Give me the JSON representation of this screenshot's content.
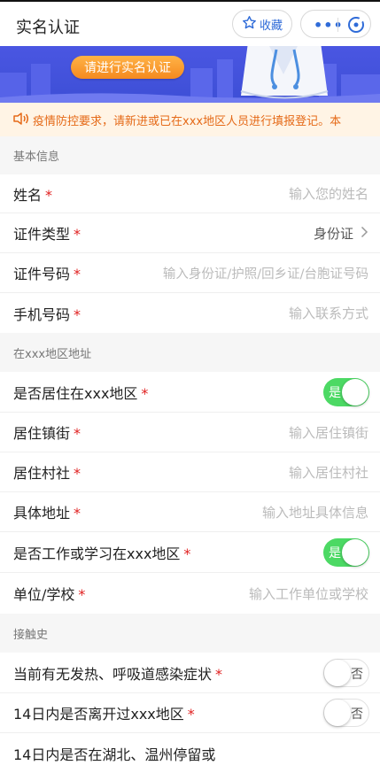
{
  "header": {
    "title": "实名认证",
    "favorite_label": "收藏",
    "more_label": "•••"
  },
  "banner": {
    "button_label": "请进行实名认证"
  },
  "notice": {
    "text": "疫情防控要求，请新进或已在xxx地区人员进行填报登记。本"
  },
  "sections": {
    "basic": "基本信息",
    "address": "在xxx地区地址",
    "contact_history": "接触史"
  },
  "required_mark": "*",
  "fields": {
    "name": {
      "label": "姓名",
      "placeholder": "输入您的姓名"
    },
    "id_type": {
      "label": "证件类型",
      "value": "身份证"
    },
    "id_number": {
      "label": "证件号码",
      "placeholder": "输入身份证/护照/回乡证/台胞证号码"
    },
    "phone": {
      "label": "手机号码",
      "placeholder": "输入联系方式"
    },
    "reside": {
      "label": "是否居住在xxx地区",
      "toggle": "是",
      "checked": true
    },
    "street": {
      "label": "居住镇街",
      "placeholder": "输入居住镇街"
    },
    "village": {
      "label": "居住村社",
      "placeholder": "输入居住村社"
    },
    "address": {
      "label": "具体地址",
      "placeholder": "输入地址具体信息"
    },
    "work_study": {
      "label": "是否工作或学习在xxx地区",
      "toggle": "是",
      "checked": true
    },
    "employer": {
      "label": "单位/学校",
      "placeholder": "输入工作单位或学校"
    },
    "symptoms": {
      "label": "当前有无发热、呼吸道感染症状",
      "toggle": "否",
      "checked": false
    },
    "left_area": {
      "label": "14日内是否离开过xxx地区",
      "toggle": "否",
      "checked": false
    },
    "stay": {
      "label": "14日内是否在湖北、温州停留或"
    }
  },
  "colors": {
    "accent": "#2f6bd8",
    "banner": "#4a56e2",
    "notice_text": "#e56a18",
    "required": "#e02020",
    "toggle_on": "#4cd964"
  }
}
